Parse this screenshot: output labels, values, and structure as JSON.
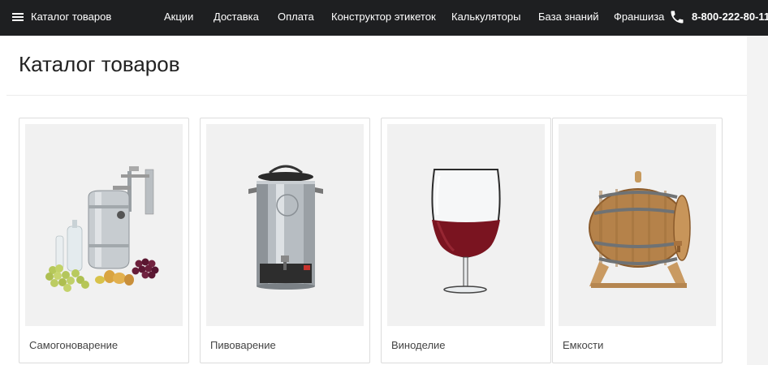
{
  "header": {
    "menu_label": "Каталог товаров",
    "menu_icon": "hamburger-icon",
    "nav": [
      "Акции",
      "Доставка",
      "Оплата",
      "Конструктор этикеток",
      "Калькуляторы",
      "База знаний",
      "Франшиза"
    ],
    "phone_icon": "phone-icon",
    "phone": "8-800-222-80-11"
  },
  "page": {
    "title": "Каталог товаров"
  },
  "categories": [
    {
      "label": "Самогоноварение",
      "image": "distiller-image"
    },
    {
      "label": "Пивоварение",
      "image": "brew-kettle-image"
    },
    {
      "label": "Виноделие",
      "image": "wine-glass-image"
    },
    {
      "label": "Емкости",
      "image": "oak-barrel-image"
    }
  ],
  "colors": {
    "topbar": "#1e1f21",
    "page_bg": "#f3f3f3",
    "wine": "#7a1420",
    "wood": "#b5824a"
  }
}
